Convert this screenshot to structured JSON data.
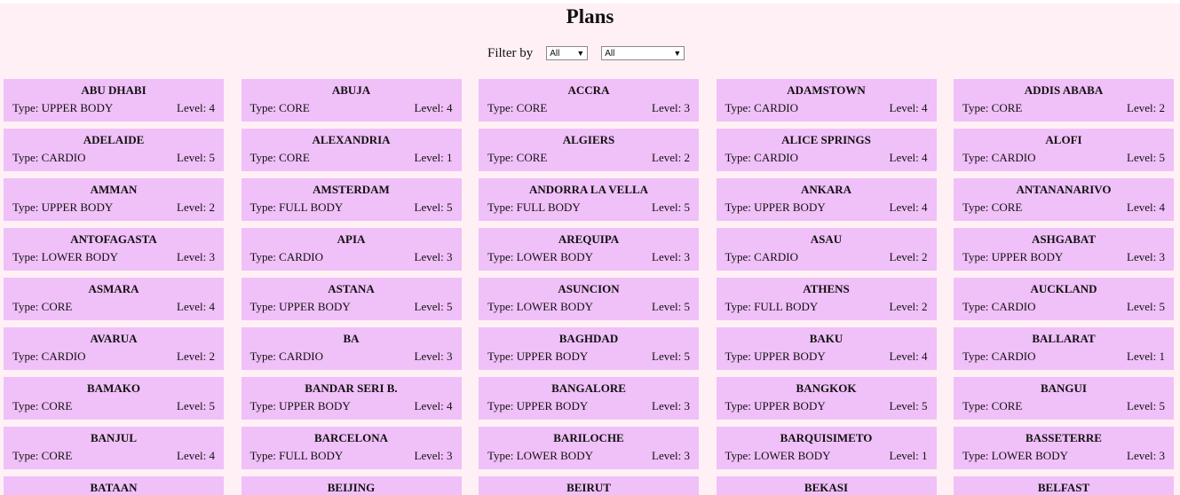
{
  "header": {
    "title": "Plans"
  },
  "filters": {
    "label": "Filter by",
    "level_value": "All",
    "type_value": "All"
  },
  "labels": {
    "type_prefix": "Type: ",
    "level_prefix": "Level: "
  },
  "plans": [
    {
      "name": "ABU DHABI",
      "type": "UPPER BODY",
      "level": 4
    },
    {
      "name": "ABUJA",
      "type": "CORE",
      "level": 4
    },
    {
      "name": "ACCRA",
      "type": "CORE",
      "level": 3
    },
    {
      "name": "ADAMSTOWN",
      "type": "CARDIO",
      "level": 4
    },
    {
      "name": "ADDIS ABABA",
      "type": "CORE",
      "level": 2
    },
    {
      "name": "ADELAIDE",
      "type": "CARDIO",
      "level": 5
    },
    {
      "name": "ALEXANDRIA",
      "type": "CORE",
      "level": 1
    },
    {
      "name": "ALGIERS",
      "type": "CORE",
      "level": 2
    },
    {
      "name": "ALICE SPRINGS",
      "type": "CARDIO",
      "level": 4
    },
    {
      "name": "ALOFI",
      "type": "CARDIO",
      "level": 5
    },
    {
      "name": "AMMAN",
      "type": "UPPER BODY",
      "level": 2
    },
    {
      "name": "AMSTERDAM",
      "type": "FULL BODY",
      "level": 5
    },
    {
      "name": "ANDORRA LA VELLA",
      "type": "FULL BODY",
      "level": 5
    },
    {
      "name": "ANKARA",
      "type": "UPPER BODY",
      "level": 4
    },
    {
      "name": "ANTANANARIVO",
      "type": "CORE",
      "level": 4
    },
    {
      "name": "ANTOFAGASTA",
      "type": "LOWER BODY",
      "level": 3
    },
    {
      "name": "APIA",
      "type": "CARDIO",
      "level": 3
    },
    {
      "name": "AREQUIPA",
      "type": "LOWER BODY",
      "level": 3
    },
    {
      "name": "ASAU",
      "type": "CARDIO",
      "level": 2
    },
    {
      "name": "ASHGABAT",
      "type": "UPPER BODY",
      "level": 3
    },
    {
      "name": "ASMARA",
      "type": "CORE",
      "level": 4
    },
    {
      "name": "ASTANA",
      "type": "UPPER BODY",
      "level": 5
    },
    {
      "name": "ASUNCION",
      "type": "LOWER BODY",
      "level": 5
    },
    {
      "name": "ATHENS",
      "type": "FULL BODY",
      "level": 2
    },
    {
      "name": "AUCKLAND",
      "type": "CARDIO",
      "level": 5
    },
    {
      "name": "AVARUA",
      "type": "CARDIO",
      "level": 2
    },
    {
      "name": "BA",
      "type": "CARDIO",
      "level": 3
    },
    {
      "name": "BAGHDAD",
      "type": "UPPER BODY",
      "level": 5
    },
    {
      "name": "BAKU",
      "type": "UPPER BODY",
      "level": 4
    },
    {
      "name": "BALLARAT",
      "type": "CARDIO",
      "level": 1
    },
    {
      "name": "BAMAKO",
      "type": "CORE",
      "level": 5
    },
    {
      "name": "BANDAR SERI B.",
      "type": "UPPER BODY",
      "level": 4
    },
    {
      "name": "BANGALORE",
      "type": "UPPER BODY",
      "level": 3
    },
    {
      "name": "BANGKOK",
      "type": "UPPER BODY",
      "level": 5
    },
    {
      "name": "BANGUI",
      "type": "CORE",
      "level": 5
    },
    {
      "name": "BANJUL",
      "type": "CORE",
      "level": 4
    },
    {
      "name": "BARCELONA",
      "type": "FULL BODY",
      "level": 3
    },
    {
      "name": "BARILOCHE",
      "type": "LOWER BODY",
      "level": 3
    },
    {
      "name": "BARQUISIMETO",
      "type": "LOWER BODY",
      "level": 1
    },
    {
      "name": "BASSETERRE",
      "type": "LOWER BODY",
      "level": 3
    },
    {
      "name": "BATAAN",
      "type": "",
      "level": null
    },
    {
      "name": "BEIJING",
      "type": "",
      "level": null
    },
    {
      "name": "BEIRUT",
      "type": "",
      "level": null
    },
    {
      "name": "BEKASI",
      "type": "",
      "level": null
    },
    {
      "name": "BELFAST",
      "type": "",
      "level": null
    }
  ]
}
